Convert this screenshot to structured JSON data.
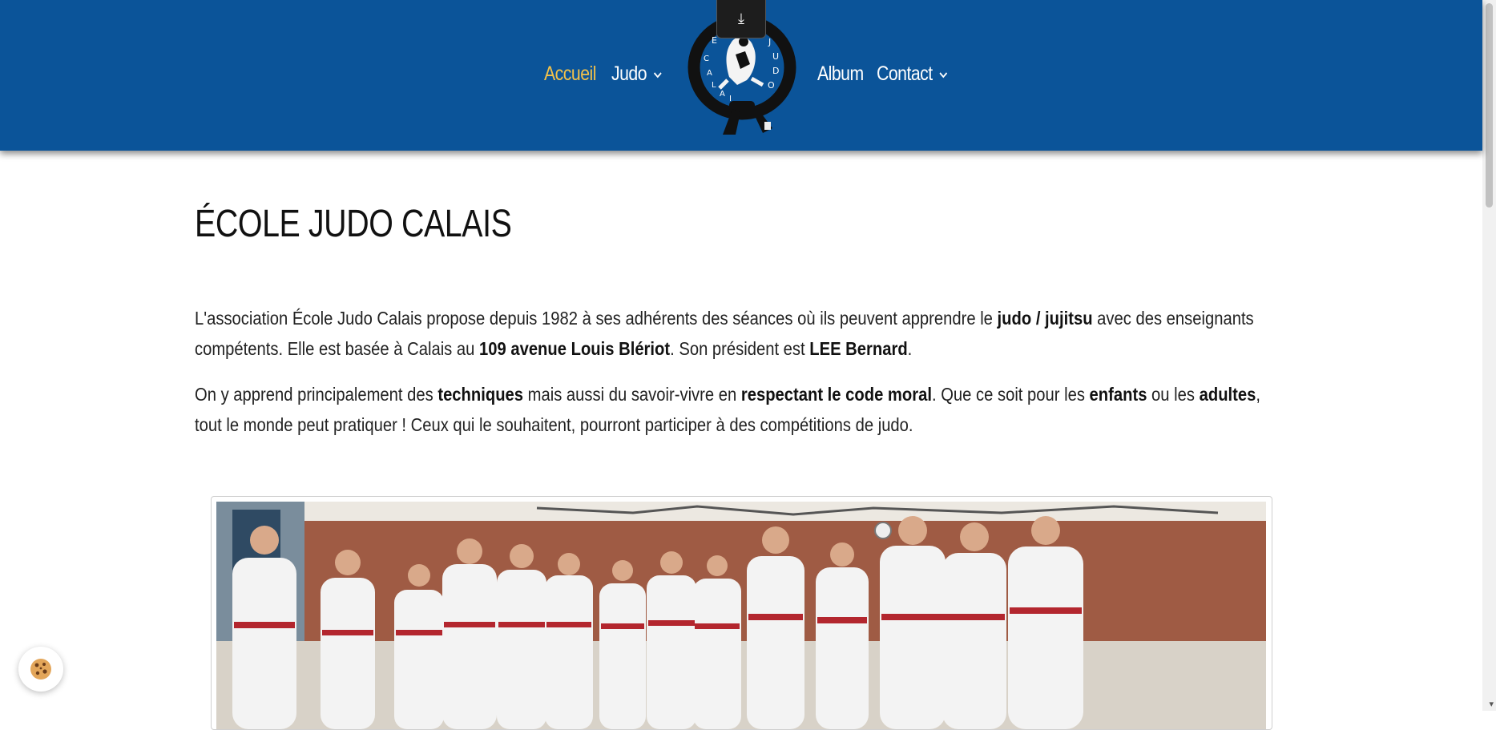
{
  "nav": {
    "accueil": "Accueil",
    "judo": "Judo",
    "album": "Album",
    "contact": "Contact",
    "chevron": "⌄",
    "download_icon": "⤓",
    "accent_color": "#f3c24a",
    "bar_color": "#0b5499"
  },
  "logo": {
    "text": "ECOLE CALAIS JUDO"
  },
  "main": {
    "title": "ÉCOLE JUDO CALAIS",
    "p1": {
      "t1": "L'association École Judo Calais propose depuis 1982 à ses adhérents des séances où ils peuvent apprendre le ",
      "b1": "judo / jujitsu",
      "t2": " avec des enseignants compétents. Elle est basée à Calais au ",
      "b2": "109 avenue Louis Blériot",
      "t3": ". Son président est ",
      "b3": "LEE Bernard",
      "t4": "."
    },
    "p2": {
      "t1": "On y apprend principalement des ",
      "b1": "techniques",
      "t2": " mais aussi du savoir-vivre en ",
      "b2": "respectant le code moral",
      "t3": ". Que ce soit pour les ",
      "b3": "enfants",
      "t4": " ou les ",
      "b4": "adultes",
      "t5": ", tout le monde peut pratiquer ! Ceux qui le souhaitent, pourront participer à des compétitions de judo."
    }
  },
  "cookie": {
    "icon": "cookie-icon"
  }
}
